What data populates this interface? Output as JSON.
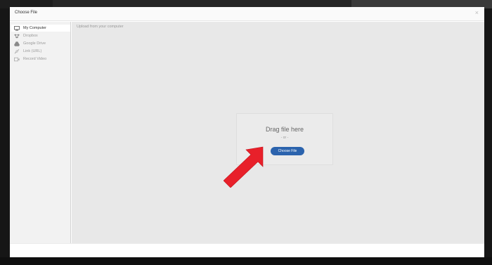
{
  "dialog": {
    "title": "Choose File",
    "close_glyph": "×"
  },
  "sidebar": {
    "items": [
      {
        "label": "My Computer",
        "icon": "computer-icon",
        "active": true
      },
      {
        "label": "Dropbox",
        "icon": "dropbox-icon",
        "active": false
      },
      {
        "label": "Google Drive",
        "icon": "google-drive-icon",
        "active": false
      },
      {
        "label": "Link (URL)",
        "icon": "link-icon",
        "active": false
      },
      {
        "label": "Record Video",
        "icon": "video-camera-icon",
        "active": false
      }
    ]
  },
  "main": {
    "caption": "Upload from your computer",
    "drop_text": "Drag file here",
    "or_text": "- or -",
    "button_label": "Choose File"
  },
  "colors": {
    "button": "#2b63ad",
    "arrow": "#e8202a",
    "sidebar_bg": "#f2f2f2",
    "main_bg": "#e8e8e8"
  }
}
